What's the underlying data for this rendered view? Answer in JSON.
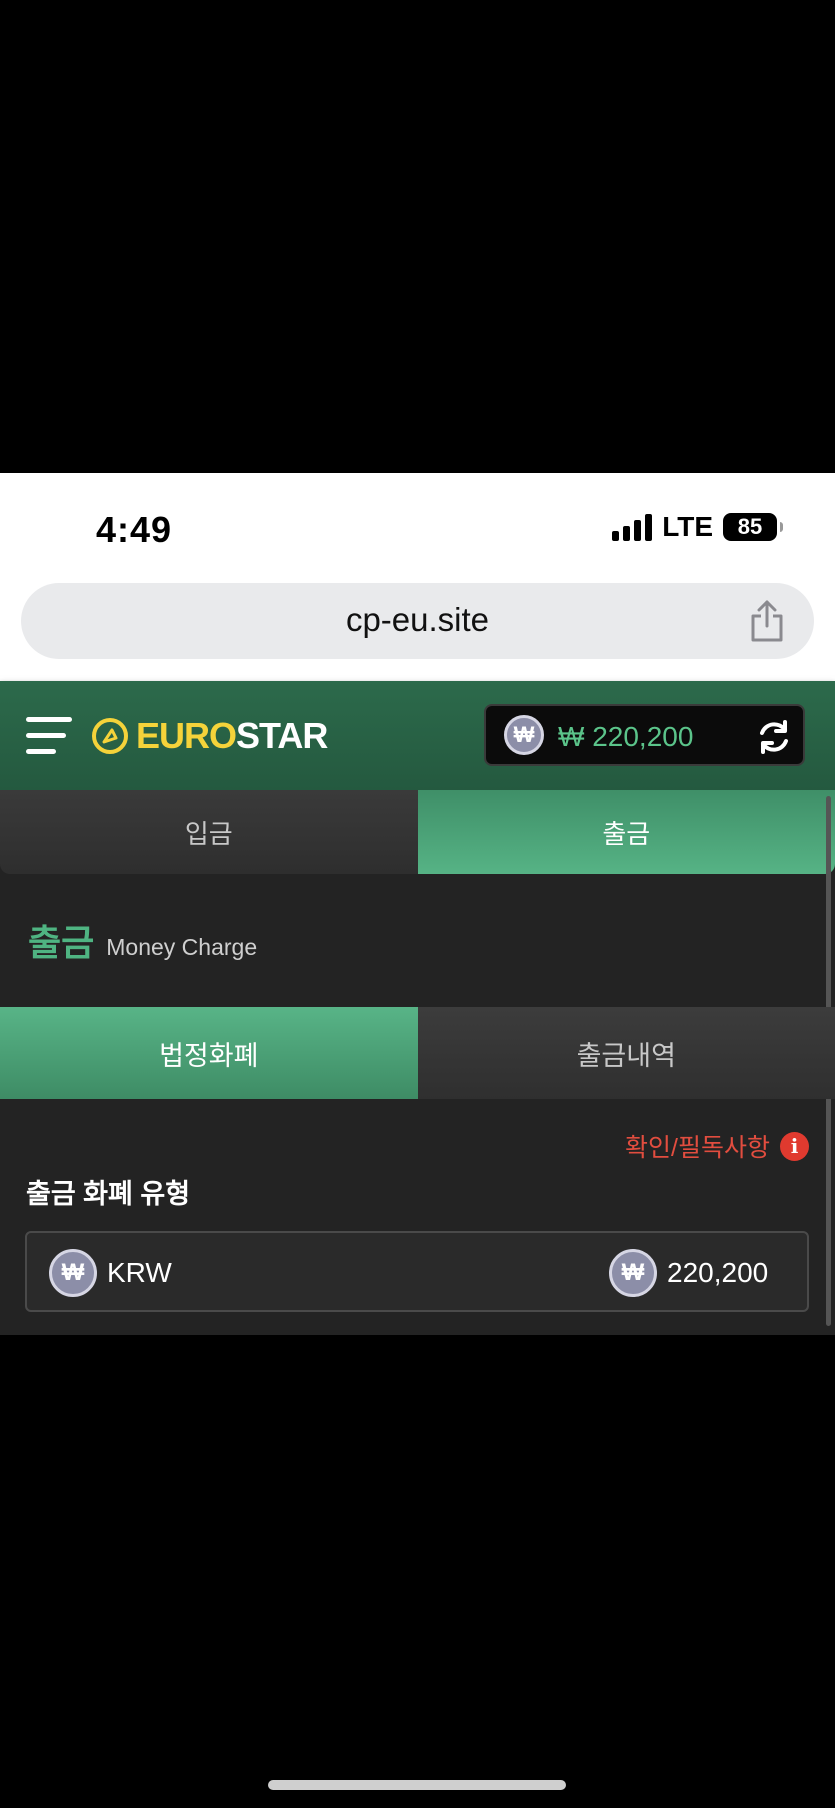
{
  "status_bar": {
    "time": "4:49",
    "network": "LTE",
    "battery": "85"
  },
  "browser": {
    "url": "cp-eu.site",
    "share_icon": "share-icon"
  },
  "header": {
    "logo_euro": "EURO",
    "logo_star": "STAR",
    "balance": "₩ 220,200",
    "coin_symbol": "₩",
    "menu_icon": "hamburger-menu-icon",
    "refresh_icon": "refresh-icon",
    "accent_color": "#5bc48a",
    "brand_green": "#2c6a4b",
    "logo_yellow": "#f5d33a"
  },
  "tabs": {
    "deposit": "입금",
    "withdraw": "출금",
    "active": "출금"
  },
  "section": {
    "title": "출금",
    "subtitle": "Money Charge"
  },
  "subtabs": {
    "fiat": "법정화폐",
    "history": "출금내역",
    "active": "법정화폐"
  },
  "notice": {
    "text": "확인/필독사항",
    "icon": "info-icon",
    "color": "#e24d3f"
  },
  "form": {
    "label": "출금 화폐 유형",
    "currency_code": "KRW",
    "currency_amount": "220,200"
  }
}
